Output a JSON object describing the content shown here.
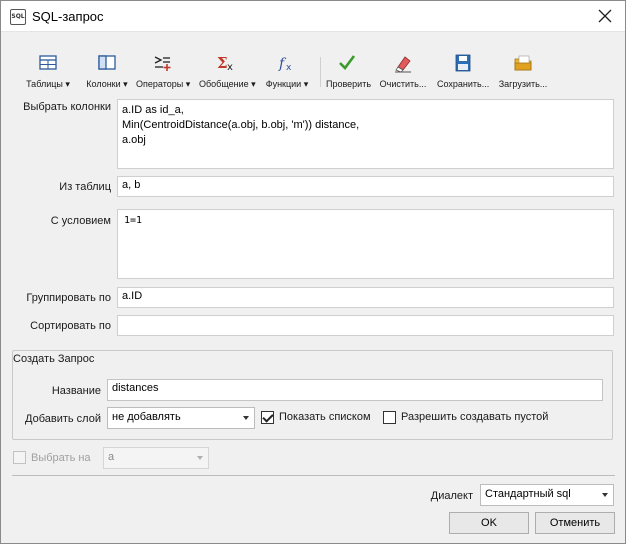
{
  "window": {
    "title": "SQL-запрос",
    "icon": "sql-file-icon",
    "icon_text": "SQL"
  },
  "toolbar": {
    "tables": "Таблицы",
    "columns": "Колонки",
    "operators": "Операторы",
    "aggregate": "Обобщение",
    "functions": "Функции",
    "check": "Проверить",
    "clear": "Очистить...",
    "save": "Сохранить...",
    "load": "Загрузить...",
    "dropdown_marker": "▾"
  },
  "form": {
    "select_label": "Выбрать колонки",
    "select_lines": [
      "a.ID as id_a,",
      "Min(CentroidDistance(a.obj, b.obj, 'm')) distance,",
      "a.obj"
    ],
    "from_label": "Из таблиц",
    "from_value": "a, b",
    "where_label": "С условием",
    "where_value": "1=1",
    "group_label": "Группировать по",
    "group_value": "a.ID",
    "order_label": "Сортировать по",
    "order_value": ""
  },
  "create_query": {
    "group_title": "Создать Запрос",
    "name_label": "Название",
    "name_value": "distances",
    "add_layer_label": "Добавить слой",
    "add_layer_value": "не добавлять",
    "show_as_list_label": "Показать списком",
    "show_as_list_checked": true,
    "allow_empty_label": "Разрешить создавать пустой",
    "allow_empty_checked": false
  },
  "select_on": {
    "label": "Выбрать на",
    "value": "a",
    "enabled": false
  },
  "dialect": {
    "label": "Диалект",
    "value": "Стандартный sql"
  },
  "buttons": {
    "ok": "OK",
    "cancel": "Отменить"
  },
  "colors": {
    "check_green": "#3a9a2a",
    "aggregate_red": "#c0392b",
    "function_blue": "#2e4f9a",
    "save_blue": "#2d6db5",
    "load_orange": "#e0a020"
  }
}
